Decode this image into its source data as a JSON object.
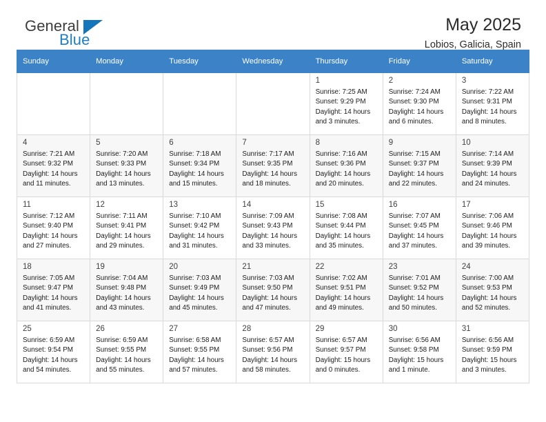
{
  "brand": {
    "name_part1": "General",
    "name_part2": "Blue",
    "accent_color": "#1575bb"
  },
  "header": {
    "title": "May 2025",
    "subtitle": "Lobios, Galicia, Spain"
  },
  "calendar": {
    "header_bg": "#3b83c6",
    "weekdays": [
      "Sunday",
      "Monday",
      "Tuesday",
      "Wednesday",
      "Thursday",
      "Friday",
      "Saturday"
    ],
    "weeks": [
      {
        "shaded": false,
        "days": [
          {
            "num": "",
            "sunrise": "",
            "sunset": "",
            "daylight_line1": "",
            "daylight_line2": ""
          },
          {
            "num": "",
            "sunrise": "",
            "sunset": "",
            "daylight_line1": "",
            "daylight_line2": ""
          },
          {
            "num": "",
            "sunrise": "",
            "sunset": "",
            "daylight_line1": "",
            "daylight_line2": ""
          },
          {
            "num": "",
            "sunrise": "",
            "sunset": "",
            "daylight_line1": "",
            "daylight_line2": ""
          },
          {
            "num": "1",
            "sunrise": "Sunrise: 7:25 AM",
            "sunset": "Sunset: 9:29 PM",
            "daylight_line1": "Daylight: 14 hours",
            "daylight_line2": "and 3 minutes."
          },
          {
            "num": "2",
            "sunrise": "Sunrise: 7:24 AM",
            "sunset": "Sunset: 9:30 PM",
            "daylight_line1": "Daylight: 14 hours",
            "daylight_line2": "and 6 minutes."
          },
          {
            "num": "3",
            "sunrise": "Sunrise: 7:22 AM",
            "sunset": "Sunset: 9:31 PM",
            "daylight_line1": "Daylight: 14 hours",
            "daylight_line2": "and 8 minutes."
          }
        ]
      },
      {
        "shaded": true,
        "days": [
          {
            "num": "4",
            "sunrise": "Sunrise: 7:21 AM",
            "sunset": "Sunset: 9:32 PM",
            "daylight_line1": "Daylight: 14 hours",
            "daylight_line2": "and 11 minutes."
          },
          {
            "num": "5",
            "sunrise": "Sunrise: 7:20 AM",
            "sunset": "Sunset: 9:33 PM",
            "daylight_line1": "Daylight: 14 hours",
            "daylight_line2": "and 13 minutes."
          },
          {
            "num": "6",
            "sunrise": "Sunrise: 7:18 AM",
            "sunset": "Sunset: 9:34 PM",
            "daylight_line1": "Daylight: 14 hours",
            "daylight_line2": "and 15 minutes."
          },
          {
            "num": "7",
            "sunrise": "Sunrise: 7:17 AM",
            "sunset": "Sunset: 9:35 PM",
            "daylight_line1": "Daylight: 14 hours",
            "daylight_line2": "and 18 minutes."
          },
          {
            "num": "8",
            "sunrise": "Sunrise: 7:16 AM",
            "sunset": "Sunset: 9:36 PM",
            "daylight_line1": "Daylight: 14 hours",
            "daylight_line2": "and 20 minutes."
          },
          {
            "num": "9",
            "sunrise": "Sunrise: 7:15 AM",
            "sunset": "Sunset: 9:37 PM",
            "daylight_line1": "Daylight: 14 hours",
            "daylight_line2": "and 22 minutes."
          },
          {
            "num": "10",
            "sunrise": "Sunrise: 7:14 AM",
            "sunset": "Sunset: 9:39 PM",
            "daylight_line1": "Daylight: 14 hours",
            "daylight_line2": "and 24 minutes."
          }
        ]
      },
      {
        "shaded": false,
        "days": [
          {
            "num": "11",
            "sunrise": "Sunrise: 7:12 AM",
            "sunset": "Sunset: 9:40 PM",
            "daylight_line1": "Daylight: 14 hours",
            "daylight_line2": "and 27 minutes."
          },
          {
            "num": "12",
            "sunrise": "Sunrise: 7:11 AM",
            "sunset": "Sunset: 9:41 PM",
            "daylight_line1": "Daylight: 14 hours",
            "daylight_line2": "and 29 minutes."
          },
          {
            "num": "13",
            "sunrise": "Sunrise: 7:10 AM",
            "sunset": "Sunset: 9:42 PM",
            "daylight_line1": "Daylight: 14 hours",
            "daylight_line2": "and 31 minutes."
          },
          {
            "num": "14",
            "sunrise": "Sunrise: 7:09 AM",
            "sunset": "Sunset: 9:43 PM",
            "daylight_line1": "Daylight: 14 hours",
            "daylight_line2": "and 33 minutes."
          },
          {
            "num": "15",
            "sunrise": "Sunrise: 7:08 AM",
            "sunset": "Sunset: 9:44 PM",
            "daylight_line1": "Daylight: 14 hours",
            "daylight_line2": "and 35 minutes."
          },
          {
            "num": "16",
            "sunrise": "Sunrise: 7:07 AM",
            "sunset": "Sunset: 9:45 PM",
            "daylight_line1": "Daylight: 14 hours",
            "daylight_line2": "and 37 minutes."
          },
          {
            "num": "17",
            "sunrise": "Sunrise: 7:06 AM",
            "sunset": "Sunset: 9:46 PM",
            "daylight_line1": "Daylight: 14 hours",
            "daylight_line2": "and 39 minutes."
          }
        ]
      },
      {
        "shaded": true,
        "days": [
          {
            "num": "18",
            "sunrise": "Sunrise: 7:05 AM",
            "sunset": "Sunset: 9:47 PM",
            "daylight_line1": "Daylight: 14 hours",
            "daylight_line2": "and 41 minutes."
          },
          {
            "num": "19",
            "sunrise": "Sunrise: 7:04 AM",
            "sunset": "Sunset: 9:48 PM",
            "daylight_line1": "Daylight: 14 hours",
            "daylight_line2": "and 43 minutes."
          },
          {
            "num": "20",
            "sunrise": "Sunrise: 7:03 AM",
            "sunset": "Sunset: 9:49 PM",
            "daylight_line1": "Daylight: 14 hours",
            "daylight_line2": "and 45 minutes."
          },
          {
            "num": "21",
            "sunrise": "Sunrise: 7:03 AM",
            "sunset": "Sunset: 9:50 PM",
            "daylight_line1": "Daylight: 14 hours",
            "daylight_line2": "and 47 minutes."
          },
          {
            "num": "22",
            "sunrise": "Sunrise: 7:02 AM",
            "sunset": "Sunset: 9:51 PM",
            "daylight_line1": "Daylight: 14 hours",
            "daylight_line2": "and 49 minutes."
          },
          {
            "num": "23",
            "sunrise": "Sunrise: 7:01 AM",
            "sunset": "Sunset: 9:52 PM",
            "daylight_line1": "Daylight: 14 hours",
            "daylight_line2": "and 50 minutes."
          },
          {
            "num": "24",
            "sunrise": "Sunrise: 7:00 AM",
            "sunset": "Sunset: 9:53 PM",
            "daylight_line1": "Daylight: 14 hours",
            "daylight_line2": "and 52 minutes."
          }
        ]
      },
      {
        "shaded": false,
        "days": [
          {
            "num": "25",
            "sunrise": "Sunrise: 6:59 AM",
            "sunset": "Sunset: 9:54 PM",
            "daylight_line1": "Daylight: 14 hours",
            "daylight_line2": "and 54 minutes."
          },
          {
            "num": "26",
            "sunrise": "Sunrise: 6:59 AM",
            "sunset": "Sunset: 9:55 PM",
            "daylight_line1": "Daylight: 14 hours",
            "daylight_line2": "and 55 minutes."
          },
          {
            "num": "27",
            "sunrise": "Sunrise: 6:58 AM",
            "sunset": "Sunset: 9:55 PM",
            "daylight_line1": "Daylight: 14 hours",
            "daylight_line2": "and 57 minutes."
          },
          {
            "num": "28",
            "sunrise": "Sunrise: 6:57 AM",
            "sunset": "Sunset: 9:56 PM",
            "daylight_line1": "Daylight: 14 hours",
            "daylight_line2": "and 58 minutes."
          },
          {
            "num": "29",
            "sunrise": "Sunrise: 6:57 AM",
            "sunset": "Sunset: 9:57 PM",
            "daylight_line1": "Daylight: 15 hours",
            "daylight_line2": "and 0 minutes."
          },
          {
            "num": "30",
            "sunrise": "Sunrise: 6:56 AM",
            "sunset": "Sunset: 9:58 PM",
            "daylight_line1": "Daylight: 15 hours",
            "daylight_line2": "and 1 minute."
          },
          {
            "num": "31",
            "sunrise": "Sunrise: 6:56 AM",
            "sunset": "Sunset: 9:59 PM",
            "daylight_line1": "Daylight: 15 hours",
            "daylight_line2": "and 3 minutes."
          }
        ]
      }
    ]
  }
}
